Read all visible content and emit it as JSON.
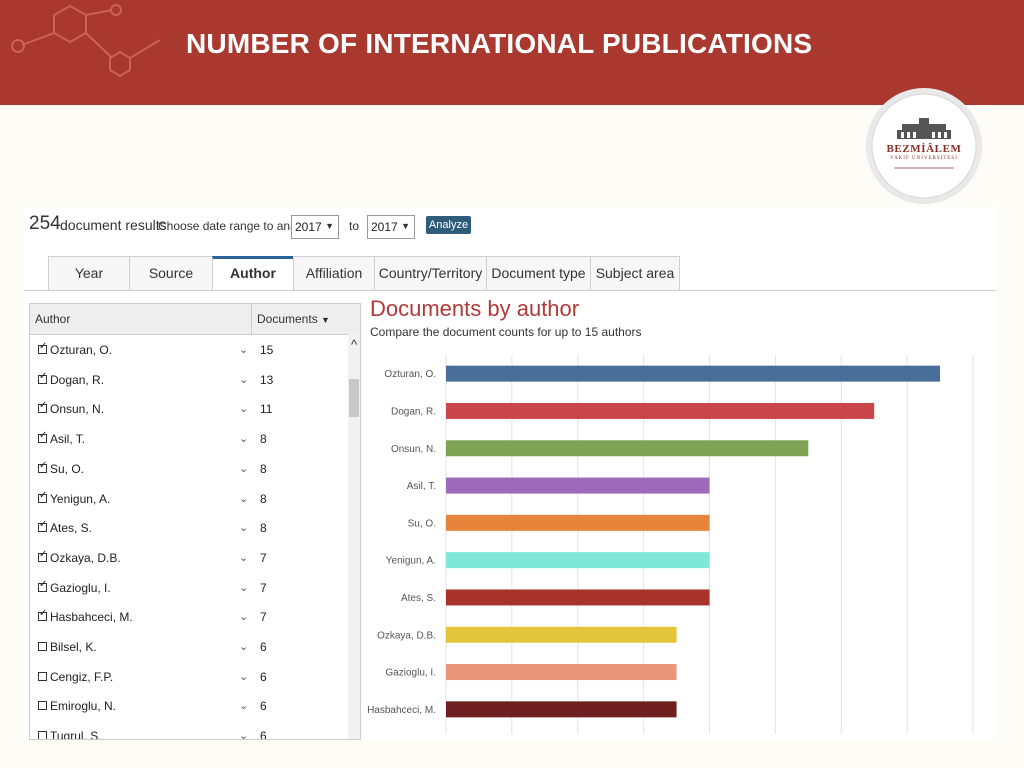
{
  "slide": {
    "title": "NUMBER OF INTERNATIONAL PUBLICATIONS",
    "logo_name": "BEZMİÂLEM",
    "logo_sub": "VAKIF ÜNİVERSİTESİ"
  },
  "colors": {
    "banner": "#a9382f",
    "accent": "#2a6496",
    "chart_title": "#b03a3a"
  },
  "toolbar": {
    "count": "254",
    "count_label": "document results",
    "range_label": "Choose date range to analyze:",
    "from_year": "2017",
    "to_label": "to",
    "to_year": "2017",
    "analyze_label": "Analyze"
  },
  "tabs": [
    {
      "label": "Year"
    },
    {
      "label": "Source"
    },
    {
      "label": "Author",
      "active": true
    },
    {
      "label": "Affiliation"
    },
    {
      "label": "Country/Territory"
    },
    {
      "label": "Document type"
    },
    {
      "label": "Subject area"
    }
  ],
  "author_table": {
    "col_author": "Author",
    "col_documents": "Documents",
    "rows": [
      {
        "name": "Ozturan, O.",
        "count": "15",
        "checked": true
      },
      {
        "name": "Dogan, R.",
        "count": "13",
        "checked": true
      },
      {
        "name": "Onsun, N.",
        "count": "11",
        "checked": true
      },
      {
        "name": "Asil, T.",
        "count": "8",
        "checked": true
      },
      {
        "name": "Su, O.",
        "count": "8",
        "checked": true
      },
      {
        "name": "Yenigun, A.",
        "count": "8",
        "checked": true
      },
      {
        "name": "Ates, S.",
        "count": "8",
        "checked": true
      },
      {
        "name": "Ozkaya, D.B.",
        "count": "7",
        "checked": true
      },
      {
        "name": "Gazioglu, I.",
        "count": "7",
        "checked": true
      },
      {
        "name": "Hasbahceci, M.",
        "count": "7",
        "checked": true
      },
      {
        "name": "Bilsel, K.",
        "count": "6",
        "checked": false
      },
      {
        "name": "Cengiz, F.P.",
        "count": "6",
        "checked": false
      },
      {
        "name": "Emiroglu, N.",
        "count": "6",
        "checked": false
      },
      {
        "name": "Tugrul, S.",
        "count": "6",
        "checked": false
      }
    ]
  },
  "chart": {
    "title": "Documents by author",
    "subtitle": "Compare the document counts for up to 15 authors"
  },
  "chart_data": {
    "type": "bar",
    "orientation": "horizontal",
    "title": "Documents by author",
    "subtitle": "Compare the document counts for up to 15 authors",
    "categories": [
      "Ozturan, O.",
      "Dogan, R.",
      "Onsun, N.",
      "Asil, T.",
      "Su, O.",
      "Yenigun, A.",
      "Ates, S.",
      "Ozkaya, D.B.",
      "Gazioglu, I.",
      "Hasbahceci, M."
    ],
    "values": [
      15,
      13,
      11,
      8,
      8,
      8,
      8,
      7,
      7,
      7
    ],
    "colors": [
      "#4a6e9a",
      "#c9474a",
      "#7fa354",
      "#9c6ab8",
      "#e6843c",
      "#7de8d5",
      "#a8332c",
      "#e3c53b",
      "#e8957a",
      "#6e1f1f"
    ],
    "xlim": [
      0,
      16
    ],
    "xticks": [
      0,
      2,
      4,
      6,
      8,
      10,
      12,
      14,
      16
    ],
    "grid": true,
    "xlabel": "",
    "ylabel": ""
  }
}
